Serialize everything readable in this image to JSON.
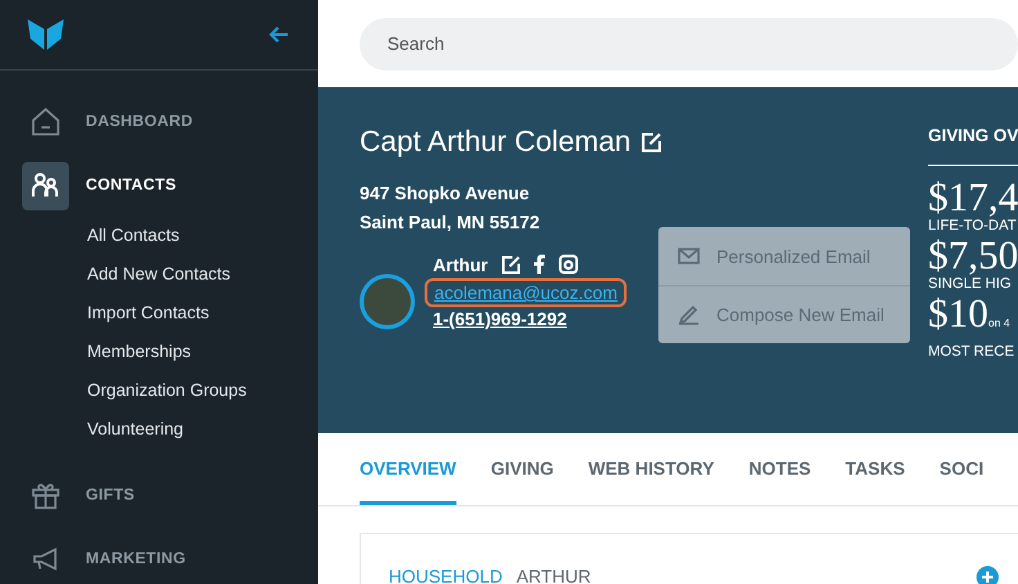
{
  "sidebar": {
    "items": [
      {
        "label": "DASHBOARD",
        "selected": false
      },
      {
        "label": "CONTACTS",
        "selected": true,
        "children": [
          {
            "label": "All Contacts"
          },
          {
            "label": "Add New Contacts"
          },
          {
            "label": "Import Contacts"
          },
          {
            "label": "Memberships"
          },
          {
            "label": "Organization Groups"
          },
          {
            "label": "Volunteering"
          }
        ]
      },
      {
        "label": "GIFTS",
        "selected": false
      },
      {
        "label": "MARKETING",
        "selected": false
      }
    ]
  },
  "search": {
    "placeholder": "Search"
  },
  "contact": {
    "name": "Capt Arthur Coleman",
    "address": [
      "947 Shopko Avenue",
      "Saint Paul, MN 55172"
    ],
    "first_name": "Arthur",
    "email": "acolemana@ucoz.com",
    "email_highlighted": true,
    "phone": "1-(651)969-1292"
  },
  "email_menu": [
    {
      "label": "Personalized Email"
    },
    {
      "label": "Compose New Email"
    }
  ],
  "giving": {
    "title": "GIVING OV",
    "stats": [
      {
        "amount": "$17,4",
        "label": "LIFE-TO-DAT"
      },
      {
        "amount": "$7,50",
        "label": "SINGLE HIG"
      },
      {
        "amount": "$10",
        "note": "on 4",
        "label": "MOST RECE"
      }
    ]
  },
  "tabs": [
    {
      "label": "OVERVIEW",
      "selected": true
    },
    {
      "label": "GIVING",
      "selected": false
    },
    {
      "label": "WEB HISTORY",
      "selected": false
    },
    {
      "label": "NOTES",
      "selected": false
    },
    {
      "label": "TASKS",
      "selected": false
    },
    {
      "label": "SOCI",
      "selected": false
    }
  ],
  "household": {
    "title": "HOUSEHOLD",
    "name": "ARTHUR"
  }
}
